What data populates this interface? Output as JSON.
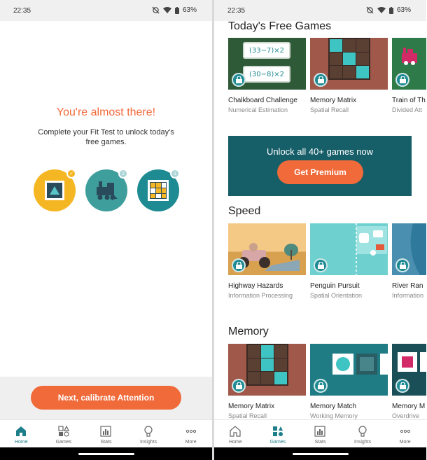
{
  "status_bar": {
    "time": "22:35",
    "battery": "63%"
  },
  "left": {
    "headline": "You're almost there!",
    "subtitle": "Complete your Fit Test to unlock today's free games.",
    "fit_test_steps": [
      {
        "icon": "play-square-icon",
        "badge": "✓",
        "color": "#f5b623",
        "state": "complete"
      },
      {
        "icon": "train-icon",
        "badge": "2",
        "color": "#3e9e9c",
        "state": "pending"
      },
      {
        "icon": "grid-puzzle-icon",
        "badge": "3",
        "color": "#1e8a92",
        "state": "pending"
      }
    ],
    "cta_label": "Next, calibrate Attention"
  },
  "right": {
    "sections": [
      {
        "title": "Today's Free Games",
        "games": [
          {
            "title": "Chalkboard Challenge",
            "category": "Numerical Estimation",
            "equation1": "(33−7)×2",
            "equation2": "(30−8)×2"
          },
          {
            "title": "Memory Matrix",
            "category": "Spatial Recall"
          },
          {
            "title": "Train of Th",
            "category": "Divided Att"
          }
        ]
      },
      {
        "title": "Speed",
        "games": [
          {
            "title": "Highway Hazards",
            "category": "Information Processing"
          },
          {
            "title": "Penguin Pursuit",
            "category": "Spatial Orientation"
          },
          {
            "title": "River Ran",
            "category": "Information"
          }
        ]
      },
      {
        "title": "Memory",
        "games": [
          {
            "title": "Memory Matrix",
            "category": "Spatial Recall"
          },
          {
            "title": "Memory Match",
            "category": "Working Memory"
          },
          {
            "title": "Memory M",
            "category": "Overdrive"
          }
        ]
      }
    ],
    "premium": {
      "text": "Unlock all 40+ games now",
      "button": "Get Premium"
    }
  },
  "nav": {
    "items": [
      {
        "label": "Home",
        "icon": "home-icon"
      },
      {
        "label": "Games",
        "icon": "games-icon"
      },
      {
        "label": "Stats",
        "icon": "stats-icon"
      },
      {
        "label": "Insights",
        "icon": "lightbulb-icon"
      },
      {
        "label": "More",
        "icon": "more-icon"
      }
    ]
  },
  "colors": {
    "accent": "#f06a3a",
    "teal": "#1e7f8a",
    "premium_bg": "#165e68"
  }
}
